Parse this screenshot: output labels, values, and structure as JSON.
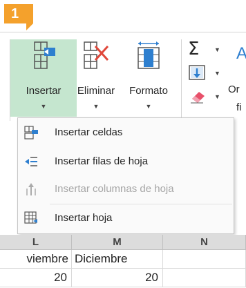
{
  "badge": {
    "number": "1"
  },
  "ribbon": {
    "insert_label": "Insertar",
    "delete_label": "Eliminar",
    "format_label": "Formato",
    "ordenar_fragment": "Or",
    "ordenar_fragment2": "fi"
  },
  "menu": {
    "items": [
      {
        "label": "Insertar celdas",
        "icon": "insert-cells-icon",
        "enabled": true
      },
      {
        "label": "Insertar filas de hoja",
        "icon": "insert-rows-icon",
        "enabled": true
      },
      {
        "label": "Insertar columnas de hoja",
        "icon": "insert-columns-icon",
        "enabled": false
      },
      {
        "label": "Insertar hoja",
        "icon": "insert-sheet-icon",
        "enabled": true
      }
    ]
  },
  "grid": {
    "col_headers": [
      "L",
      "M",
      "N"
    ],
    "rows": [
      [
        "viembre",
        "Diciembre",
        ""
      ],
      [
        "20",
        "20",
        ""
      ]
    ]
  },
  "colors": {
    "accent_green": "#217346",
    "selected_button": "#c5e6cf",
    "badge_orange": "#f4a12c",
    "delete_red": "#e0473a"
  }
}
